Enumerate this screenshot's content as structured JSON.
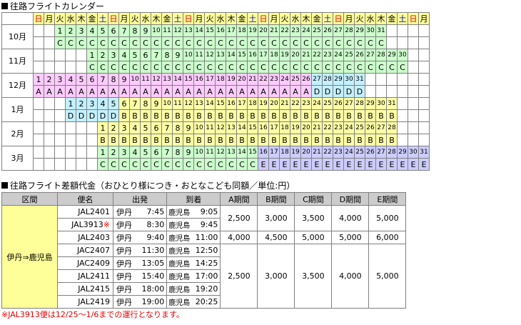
{
  "calendar": {
    "title": "往路フライトカレンダー",
    "day_header": [
      "日",
      "月",
      "火",
      "水",
      "木",
      "金",
      "土",
      "日",
      "月",
      "火",
      "水",
      "木",
      "金",
      "土",
      "日",
      "月",
      "火",
      "水",
      "木",
      "金",
      "土",
      "日",
      "月",
      "火",
      "水",
      "木",
      "金",
      "土",
      "日",
      "月",
      "火",
      "水",
      "木",
      "金",
      "土",
      "日",
      "月"
    ],
    "colors": {
      "A": "#ffcbff",
      "B": "#ffffa6",
      "C": "#ccffcc",
      "D": "#c3f0ff",
      "E": "#ccccff",
      "weekday_header": "#ffff99",
      "sunday": "#e60000",
      "saturday": "#0000cc"
    },
    "months": [
      {
        "label": "10月",
        "start": 2,
        "days": 31,
        "periods": "CCCCCCCCCCCCCCCCCCCCCCCCCCCCCCC"
      },
      {
        "label": "11月",
        "start": 5,
        "days": 30,
        "periods": "CCCCCCCCCCCCCCCCCCCCCCCCCCCCCC"
      },
      {
        "label": "12月",
        "start": 0,
        "days": 31,
        "periods": "AAAAAAAAAAAAAAAAAAAAAAAAAADDDDD"
      },
      {
        "label": "1月",
        "start": 3,
        "days": 31,
        "periods": "DDDDDBBBBBBBBBBBBBBBBBBBBBBBBBB"
      },
      {
        "label": "2月",
        "start": 6,
        "days": 28,
        "periods": "BBBBBBBBBBBBBBBBBBBBBBBBBBBB"
      },
      {
        "label": "3月",
        "start": 6,
        "days": 31,
        "periods": "CCCCCCCCCCCCCCCEEEEEEEEEEEEEEEE"
      }
    ]
  },
  "fares": {
    "title": "往路フライト差額代金（おひとり様につき・おとなこども同額／単位:円）",
    "headers": {
      "route": "区間",
      "flight": "便名",
      "departure": "出発",
      "arrival": "到着",
      "a": "A期間",
      "b": "B期間",
      "c": "C期間",
      "d": "D期間",
      "e": "E期間"
    },
    "route": "伊丹⇒鹿児島",
    "flights": [
      {
        "no": "JAL2401",
        "mark": "",
        "dep_city": "伊丹",
        "dep_time": "7:45",
        "arr_city": "鹿児島",
        "arr_time": "9:05"
      },
      {
        "no": "JAL3913",
        "mark": "※",
        "dep_city": "伊丹",
        "dep_time": "8:30",
        "arr_city": "鹿児島",
        "arr_time": "9:45"
      },
      {
        "no": "JAL2403",
        "mark": "",
        "dep_city": "伊丹",
        "dep_time": "9:40",
        "arr_city": "鹿児島",
        "arr_time": "11:00"
      },
      {
        "no": "JAC2407",
        "mark": "",
        "dep_city": "伊丹",
        "dep_time": "11:30",
        "arr_city": "鹿児島",
        "arr_time": "12:50"
      },
      {
        "no": "JAC2409",
        "mark": "",
        "dep_city": "伊丹",
        "dep_time": "13:05",
        "arr_city": "鹿児島",
        "arr_time": "14:25"
      },
      {
        "no": "JAL2411",
        "mark": "",
        "dep_city": "伊丹",
        "dep_time": "15:40",
        "arr_city": "鹿児島",
        "arr_time": "17:00"
      },
      {
        "no": "JAL2415",
        "mark": "",
        "dep_city": "伊丹",
        "dep_time": "18:00",
        "arr_city": "鹿児島",
        "arr_time": "19:20"
      },
      {
        "no": "JAL2419",
        "mark": "",
        "dep_city": "伊丹",
        "dep_time": "19:00",
        "arr_city": "鹿児島",
        "arr_time": "20:25"
      }
    ],
    "price_groups": [
      {
        "rows": 2,
        "prices": [
          "2,500",
          "3,000",
          "3,500",
          "4,000",
          "5,000"
        ]
      },
      {
        "rows": 1,
        "prices": [
          "4,000",
          "4,500",
          "5,000",
          "5,000",
          "6,000"
        ]
      },
      {
        "rows": 5,
        "prices": [
          "2,500",
          "3,000",
          "3,500",
          "4,000",
          "5,000"
        ]
      }
    ],
    "note": "※JAL3913便は12/25～1/6までの運行となります。"
  }
}
